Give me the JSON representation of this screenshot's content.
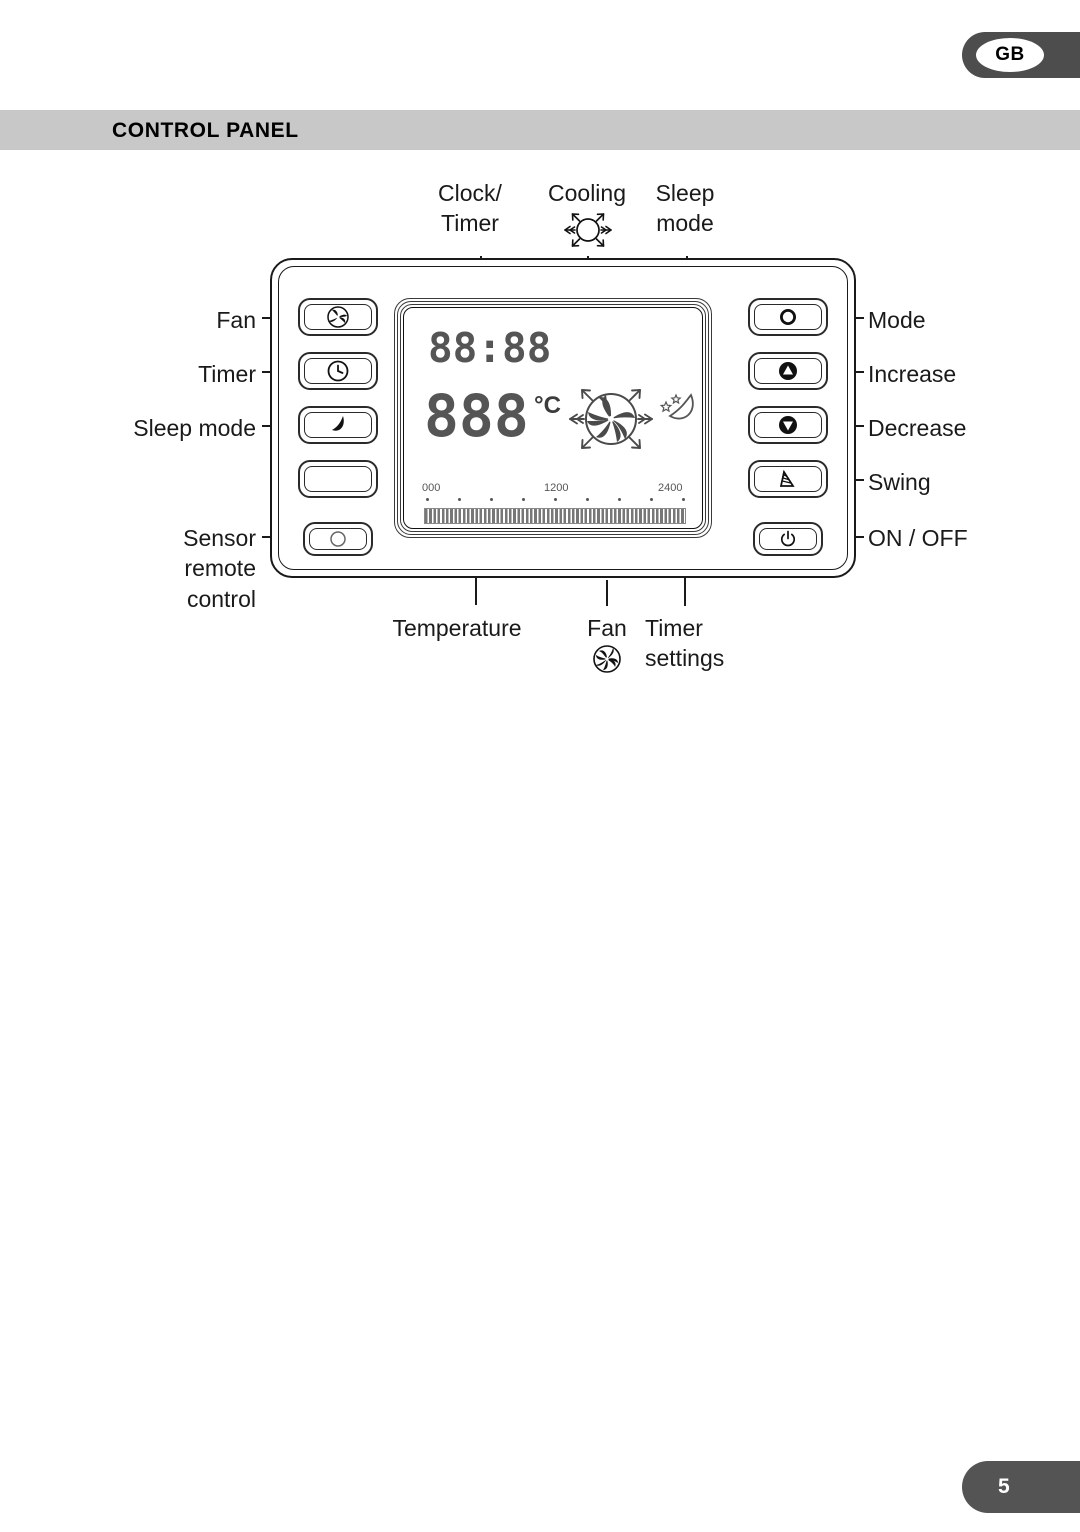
{
  "language_badge": {
    "code": "GB"
  },
  "header": {
    "title": "CONTROL PANEL"
  },
  "page": {
    "number": "5"
  },
  "callouts": {
    "top": [
      {
        "id": "clock-timer",
        "label": "Clock/\nTimer",
        "line1": "Clock/",
        "line2": "Timer"
      },
      {
        "id": "cooling",
        "label": "Cooling",
        "icon": "cooling-snowflake-icon"
      },
      {
        "id": "sleep-mode-display",
        "label": "Sleep\nmode",
        "line1": "Sleep",
        "line2": "mode"
      }
    ],
    "left": [
      {
        "id": "fan",
        "label": "Fan"
      },
      {
        "id": "timer",
        "label": "Timer"
      },
      {
        "id": "sleep-mode",
        "label": "Sleep mode"
      },
      {
        "id": "sensor-remote-control",
        "line1": "Sensor",
        "line2": "remote",
        "line3": "control"
      }
    ],
    "right": [
      {
        "id": "mode",
        "label": "Mode"
      },
      {
        "id": "increase",
        "label": "Increase"
      },
      {
        "id": "decrease",
        "label": "Decrease"
      },
      {
        "id": "swing",
        "label": "Swing"
      },
      {
        "id": "on-off",
        "label": "ON / OFF"
      }
    ],
    "bottom": [
      {
        "id": "temperature",
        "label": "Temperature"
      },
      {
        "id": "fan-speed",
        "label": "Fan",
        "icon": "fan-pinwheel-icon"
      },
      {
        "id": "timer-settings",
        "line1": "Timer",
        "line2": "settings"
      }
    ]
  },
  "lcd": {
    "clock_value": "88:88",
    "temperature_value": "888",
    "temperature_unit": "°C",
    "icons": [
      {
        "id": "fan-snowflake-icon",
        "name": "fan-snowflake-icon"
      },
      {
        "id": "sleep-moon-icon",
        "name": "moon-stars-icon"
      }
    ],
    "timer_scale": {
      "labels": [
        "000",
        "1200",
        "2400"
      ],
      "tick_count": 9,
      "bar_segments": 62
    }
  },
  "buttons": {
    "left": [
      {
        "id": "fan-button",
        "icon": "fan-blades-icon"
      },
      {
        "id": "timer-button",
        "icon": "clock-icon"
      },
      {
        "id": "sleep-mode-button",
        "icon": "moon-icon"
      },
      {
        "id": "blank-button",
        "icon": "none"
      },
      {
        "id": "sensor-button",
        "icon": "sensor-circle-icon"
      }
    ],
    "right": [
      {
        "id": "mode-button",
        "icon": "filled-circle-icon"
      },
      {
        "id": "increase-button",
        "icon": "triangle-up-icon"
      },
      {
        "id": "decrease-button",
        "icon": "triangle-down-icon"
      },
      {
        "id": "swing-button",
        "icon": "swing-louver-icon"
      },
      {
        "id": "power-button",
        "icon": "power-icon"
      }
    ]
  },
  "colors": {
    "header_band": "#c8c8c8",
    "badge": "#4d4d4d",
    "page_tab": "#545454",
    "line": "#1a1a1a",
    "lcd_segment": "#555555"
  }
}
